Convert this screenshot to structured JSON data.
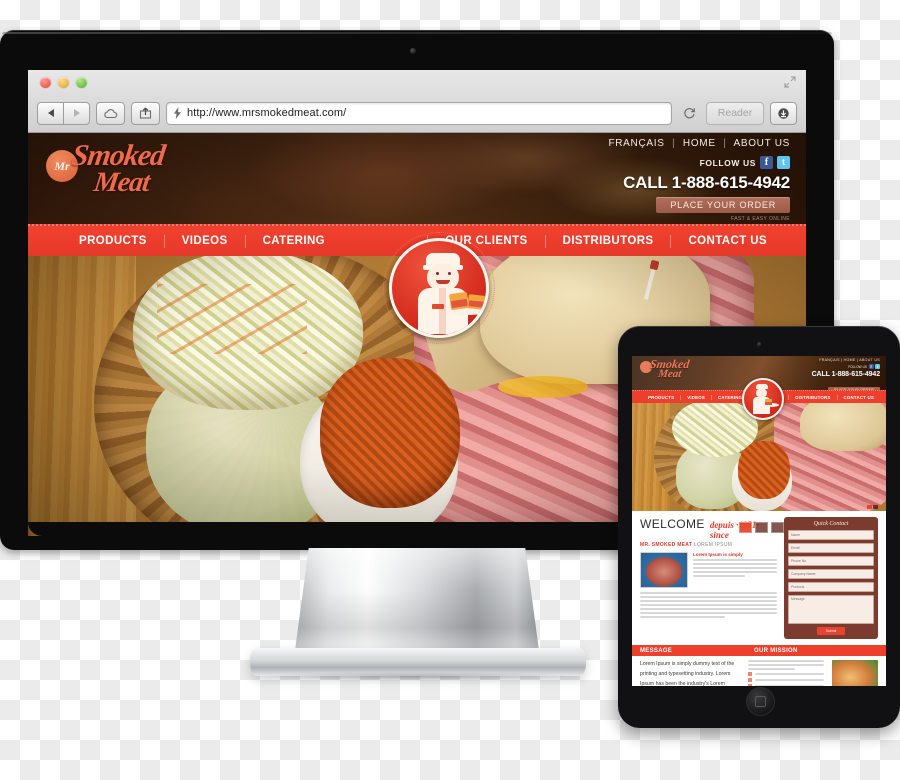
{
  "browser": {
    "url": "http://www.mrsmokedmeat.com/",
    "back_label": "Back",
    "forward_label": "Forward",
    "icloud_label": "iCloud Tabs",
    "share_label": "Share",
    "reload_label": "Reload",
    "reader_label": "Reader",
    "downloads_label": "Downloads",
    "traffic_lights": [
      "close",
      "minimize",
      "zoom"
    ]
  },
  "site": {
    "logo": {
      "badge": "Mr",
      "word_line1": "Smoked",
      "word_line2": "Meat"
    },
    "top_links": [
      "FRANÇAIS",
      "HOME",
      "ABOUT US"
    ],
    "separator": "|",
    "follow_label": "FOLLOW US",
    "social": [
      {
        "name": "facebook",
        "glyph": "f",
        "color": "#3b5998"
      },
      {
        "name": "twitter",
        "glyph": "t",
        "color": "#5ec5ec"
      }
    ],
    "phone": "CALL 1-888-615-4942",
    "order_button": "PLACE YOUR ORDER",
    "order_sub": "FAST & EASY ONLINE",
    "nav_left": [
      "PRODUCTS",
      "VIDEOS",
      "CATERING"
    ],
    "nav_right": [
      "OUR CLIENTS",
      "DISTRIBUTORS",
      "CONTACT US"
    ],
    "mascot_alt": "butcher-mascot-with-sandwich-plate",
    "hero_alt": "smoked-meat-sandwich-coleslaw-waffle-fries-basket",
    "slider_dots": 3
  },
  "tablet": {
    "welcome_title": "WELCOME",
    "since_text": "depuis ·1951· since",
    "subtitle_brand": "MR. SMOKED MEAT",
    "subtitle_rest": "LOREM IPSUM",
    "intro_heading": "Lorem Ipsum is simply",
    "quick_contact": {
      "title": "Quick Contact",
      "fields": [
        "Name",
        "Email",
        "Phone No",
        "Company Name",
        "Products",
        "Message"
      ],
      "submit": "Submit"
    },
    "sections": [
      "MESSAGE",
      "OUR MISSION"
    ],
    "message_text": "Lorem Ipsum is simply dummy text of the printing and typesetting industry. Lorem Ipsum has been the industry's Lorem Lorem Ipsum is simply dummy text of the printing",
    "bullets": [
      "Lorem Ipsum is simply",
      "Lorem Ipsum is simply dummy text",
      "Lorem Ipsum is",
      "Lorem Ipsum is simply"
    ],
    "home_button": "home-button"
  },
  "colors": {
    "brand_red": "#ee3f2d",
    "logo_orange": "#ef6a4a",
    "header_brown": "#5a341b",
    "quick_contact_brown": "#7b3b2e",
    "facebook_blue": "#3b5998",
    "twitter_blue": "#5ec5ec"
  }
}
